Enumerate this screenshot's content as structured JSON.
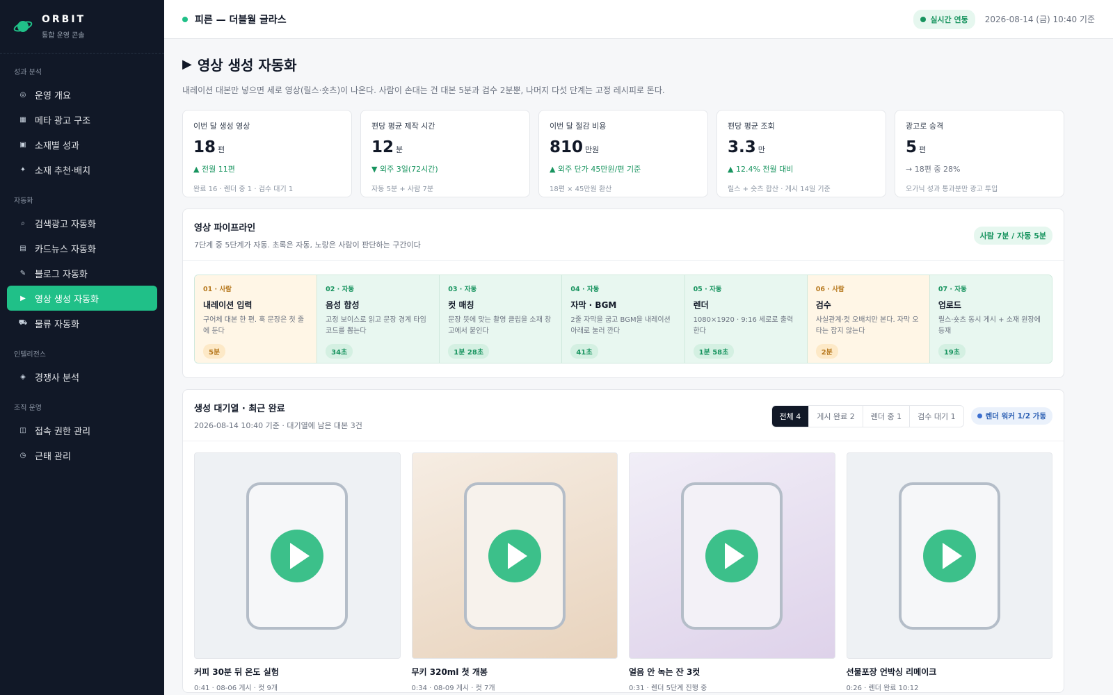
{
  "brand": {
    "name": "ORBIT",
    "subtitle": "통합 운영 콘솔"
  },
  "sidebar": {
    "sections": [
      {
        "label": "성과 분석",
        "items": [
          {
            "label": "운영 개요",
            "icon": "circle-dot-icon"
          },
          {
            "label": "메타 광고 구조",
            "icon": "grid-icon"
          },
          {
            "label": "소재별 성과",
            "icon": "square-icon"
          },
          {
            "label": "소재 추천·배치",
            "icon": "sparkle-icon"
          }
        ]
      },
      {
        "label": "자동화",
        "items": [
          {
            "label": "검색광고 자동화",
            "icon": "search-icon"
          },
          {
            "label": "카드뉴스 자동화",
            "icon": "cards-icon"
          },
          {
            "label": "블로그 자동화",
            "icon": "pencil-icon"
          },
          {
            "label": "영상 생성 자동화",
            "icon": "play-icon",
            "active": true
          },
          {
            "label": "물류 자동화",
            "icon": "truck-icon"
          }
        ]
      },
      {
        "label": "인텔리전스",
        "items": [
          {
            "label": "경쟁사 분석",
            "icon": "diamond-icon"
          }
        ]
      },
      {
        "label": "조직 운영",
        "items": [
          {
            "label": "접속 권한 관리",
            "icon": "lock-icon"
          },
          {
            "label": "근태 관리",
            "icon": "clock-icon"
          }
        ]
      }
    ]
  },
  "topbar": {
    "title": "피른 — 더블월 글라스",
    "live": "실시간 연동",
    "time": "2026-08-14 (금) 10:40 기준"
  },
  "page": {
    "title": "영상 생성 자동화",
    "desc": "내레이션 대본만 넣으면 세로 영상(릴스·숏츠)이 나온다. 사람이 손대는 건 대본 5분과 검수 2분뿐, 나머지 다섯 단계는 고정 레시피로 돈다."
  },
  "stats": [
    {
      "label": "이번 달 생성 영상",
      "value": "18",
      "unit": "편",
      "delta": "▲ 전월 11편",
      "foot": "완료 16 · 렌더 중 1 · 검수 대기 1"
    },
    {
      "label": "편당 평균 제작 시간",
      "value": "12",
      "unit": "분",
      "delta": "▼ 외주 3일(72시간)",
      "foot": "자동 5분 + 사람 7분"
    },
    {
      "label": "이번 달 절감 비용",
      "value": "810",
      "unit": "만원",
      "delta": "▲ 외주 단가 45만원/편 기준",
      "foot": "18편 × 45만원 환산"
    },
    {
      "label": "편당 평균 조회",
      "value": "3.3",
      "unit": "만",
      "delta": "▲ 12.4% 전월 대비",
      "foot": "릴스 + 숏츠 합산 · 게시 14일 기준"
    },
    {
      "label": "광고로 승격",
      "value": "5",
      "unit": "편",
      "delta": "→ 18편 중 28%",
      "foot": "오가닉 성과 통과분만 광고 투입"
    }
  ],
  "pipeline": {
    "title": "영상 파이프라인",
    "subtitle": "7단계 중 5단계가 자동. 초록은 자동, 노랑은 사람이 판단하는 구간이다",
    "badge": "사람 7분 / 자동 5분",
    "steps": [
      {
        "tag": "01 · 사람",
        "name": "내레이션 입력",
        "desc": "구어체 대본 한 편. 훅 문장은 첫 줄에 둔다",
        "time": "5분",
        "kind": "human"
      },
      {
        "tag": "02 · 자동",
        "name": "음성 합성",
        "desc": "고정 보이스로 읽고 문장 경계 타임코드를 뽑는다",
        "time": "34초",
        "kind": "auto"
      },
      {
        "tag": "03 · 자동",
        "name": "컷 매칭",
        "desc": "문장 뜻에 맞는 촬영 클립을 소재 창고에서 붙인다",
        "time": "1분 28초",
        "kind": "auto"
      },
      {
        "tag": "04 · 자동",
        "name": "자막 · BGM",
        "desc": "2줄 자막을 굽고 BGM을 내레이션 아래로 눌러 깐다",
        "time": "41초",
        "kind": "auto"
      },
      {
        "tag": "05 · 자동",
        "name": "렌더",
        "desc": "1080×1920 · 9:16 세로로 출력한다",
        "time": "1분 58초",
        "kind": "auto"
      },
      {
        "tag": "06 · 사람",
        "name": "검수",
        "desc": "사실관계·컷 오배치만 본다. 자막 오타는 잡지 않는다",
        "time": "2분",
        "kind": "human"
      },
      {
        "tag": "07 · 자동",
        "name": "업로드",
        "desc": "릴스·숏츠 동시 게시 + 소재 원장에 등재",
        "time": "19초",
        "kind": "auto"
      }
    ]
  },
  "queue": {
    "title": "생성 대기열 · 최근 완료",
    "subtitle": "2026-08-14 10:40 기준 · 대기열에 남은 대본 3건",
    "tabs": [
      "전체 4",
      "게시 완료 2",
      "렌더 중 1",
      "검수 대기 1"
    ],
    "worker": "렌더 워커 1/2 가동",
    "videos": [
      {
        "title": "커피 30분 뒤 온도 실험",
        "meta": "0:41 · 08-06 게시 · 컷 9개",
        "bg": "#eef1f4"
      },
      {
        "title": "무키 320ml 첫 개봉",
        "meta": "0:34 · 08-09 게시 · 컷 7개",
        "bg": "linear-gradient(160deg,#f6ede3,#e8d3bd)"
      },
      {
        "title": "얼음 안 녹는 잔 3컷",
        "meta": "0:31 · 렌더 5단계 진행 중",
        "bg": "linear-gradient(160deg,#f1eef7,#ded2ea)"
      },
      {
        "title": "선물포장 언박싱 리메이크",
        "meta": "0:26 · 렌더 완료 10:12",
        "bg": "#eef1f4"
      }
    ]
  },
  "colors": {
    "accent": "#20c088",
    "sidebar": "#111827",
    "human": "#fff6e6",
    "auto": "#e8f7f0"
  }
}
